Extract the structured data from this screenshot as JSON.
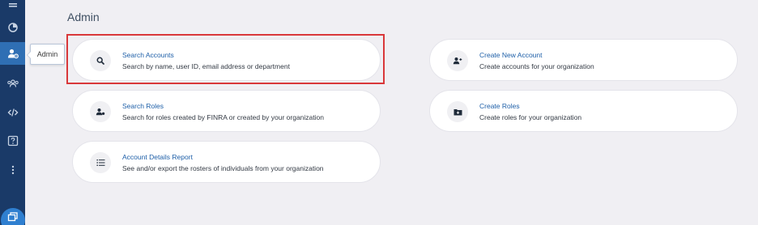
{
  "tooltip": {
    "label": "Admin"
  },
  "page": {
    "title": "Admin"
  },
  "cards": [
    {
      "id": "search-accounts",
      "title": "Search Accounts",
      "description": "Search by name, user ID, email address or department",
      "icon": "search-icon"
    },
    {
      "id": "create-new-account",
      "title": "Create New Account",
      "description": "Create accounts for your organization",
      "icon": "add-user-icon"
    },
    {
      "id": "search-roles",
      "title": "Search Roles",
      "description": "Search for roles created by FINRA or created by your organization",
      "icon": "role-user-icon"
    },
    {
      "id": "create-roles",
      "title": "Create Roles",
      "description": "Create roles for your organization",
      "icon": "folder-add-icon"
    },
    {
      "id": "account-details-report",
      "title": "Account Details Report",
      "description": "See and/or export the rosters of individuals from your organization",
      "icon": "list-icon"
    }
  ],
  "sidebar": {
    "items": [
      "menu-icon",
      "pie-chart-icon",
      "admin-user-icon",
      "group-icon",
      "code-icon",
      "help-icon",
      "more-icon"
    ],
    "active": "admin-user-icon",
    "bottom_button_icon": "windows-icon"
  },
  "colors": {
    "sidebar": "#1a3a68",
    "active": "#2f6fb4",
    "link": "#1e5fa8",
    "highlight": "#d9383a"
  }
}
